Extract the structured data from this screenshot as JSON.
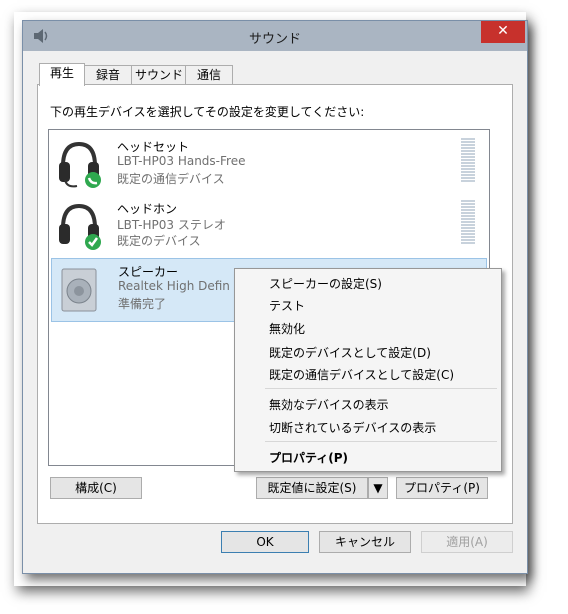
{
  "window": {
    "title": "サウンド",
    "close_label": "✕"
  },
  "tabs": [
    {
      "label": "再生"
    },
    {
      "label": "録音"
    },
    {
      "label": "サウンド"
    },
    {
      "label": "通信"
    }
  ],
  "instruction": "下の再生デバイスを選択してその設定を変更してください:",
  "devices": [
    {
      "name": "ヘッドセット",
      "model": "LBT-HP03 Hands-Free",
      "status": "既定の通信デバイス",
      "icon": "headset-icon"
    },
    {
      "name": "ヘッドホン",
      "model": "LBT-HP03 ステレオ",
      "status": "既定のデバイス",
      "icon": "headphones-icon"
    },
    {
      "name": "スピーカー",
      "model": "Realtek High Defin",
      "status": "準備完了",
      "icon": "speaker-icon"
    }
  ],
  "context_menu": {
    "items": [
      "スピーカーの設定(S)",
      "テスト",
      "無効化",
      "既定のデバイスとして設定(D)",
      "既定の通信デバイスとして設定(C)",
      "無効なデバイスの表示",
      "切断されているデバイスの表示",
      "プロパティ(P)"
    ]
  },
  "buttons": {
    "configure": "構成(C)",
    "set_default": "既定値に設定(S)",
    "properties": "プロパティ(P)",
    "ok": "OK",
    "cancel": "キャンセル",
    "apply": "適用(A)"
  },
  "colors": {
    "close_button": "#c7312c",
    "selection": "#d5e8f7",
    "default_badge": "#2fa84f"
  }
}
